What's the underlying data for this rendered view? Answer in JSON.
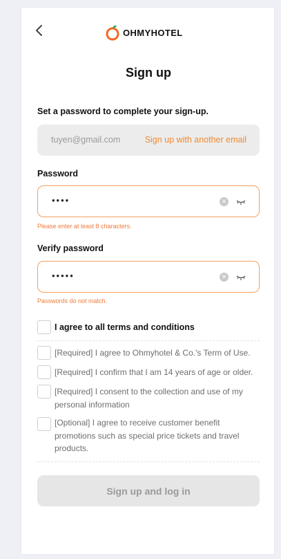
{
  "header": {
    "logo_text": "OHMYHOTEL",
    "back_icon": "chevron-left-icon"
  },
  "title": "Sign up",
  "subtitle": "Set a password to complete your sign-up.",
  "email": {
    "value": "tuyen@gmail.com",
    "link_label": "Sign up with another email"
  },
  "password": {
    "label": "Password",
    "masked_value": "••••",
    "error": "Please enter at least 8 characters."
  },
  "verify_password": {
    "label": "Verify password",
    "masked_value": "•••••",
    "error": "Passwords do not match."
  },
  "agree_all_label": "I agree to all terms and conditions",
  "terms": [
    "[Required] I agree to Ohmyhotel & Co.'s Term of Use.",
    "[Required] I confirm that I am 14 years of age or older.",
    "[Required] I consent to the collection and use of my personal information",
    "[Optional] I agree to receive customer benefit promotions such as special price tickets and travel products."
  ],
  "submit_label": "Sign up and log in",
  "colors": {
    "accent": "#f08a33",
    "error": "#ef7b3a",
    "disabled_bg": "#e6e6e6"
  }
}
